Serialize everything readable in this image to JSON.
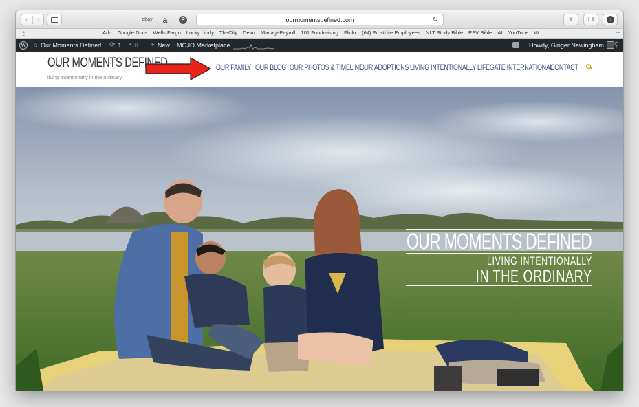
{
  "browser": {
    "url": "ourmomentsdefined.com",
    "favorites_icons": [
      "ebay",
      "a",
      "P"
    ],
    "bookmarks": [
      "Arlo",
      "Google Docs",
      "Wells Fargo",
      "Lucky Lindy",
      "TheCity",
      "Devo",
      "ManagePayroll",
      "101 Fundraising",
      "Flickr",
      "(64) Frostbite Employees",
      "NLT Study Bible",
      "ESV Bible",
      "AI",
      "YouTube",
      "W"
    ]
  },
  "adminbar": {
    "site_name": "Our Moments Defined",
    "updates_count": "1",
    "comments_count": "0",
    "new_label": "New",
    "mojo_label": "MOJO Marketplace",
    "howdy": "Howdy, Ginger Newingham"
  },
  "site": {
    "title": "OUR MOMENTS DEFINED",
    "tagline": "living intentionally in the ordinary",
    "nav": [
      "OUR FAMILY",
      "OUR BLOG",
      "OUR PHOTOS & TIMELINE",
      "OUR ADOPTIONS",
      "LIVING INTENTIONALLY",
      "LIFEGATE INTERNATIONAL",
      "CONTACT"
    ]
  },
  "hero": {
    "title": "OUR MOMENTS DEFINED",
    "line1": "LIVING INTENTIONALLY",
    "line2": "IN THE ORDINARY"
  },
  "colors": {
    "nav_text": "#3b4b82",
    "accent": "#d4a018",
    "arrow": "#e8231a",
    "adminbar": "#23282d"
  }
}
